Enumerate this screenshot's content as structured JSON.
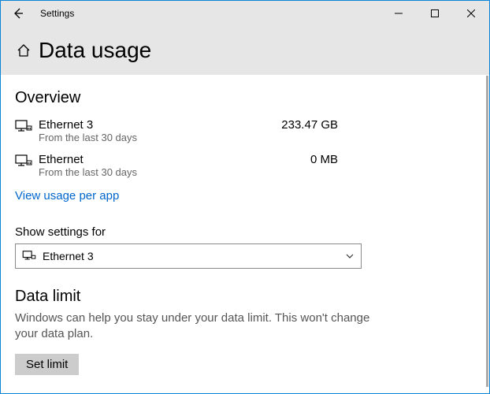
{
  "window": {
    "app_name": "Settings",
    "title": "Data usage"
  },
  "overview": {
    "heading": "Overview",
    "items": [
      {
        "name": "Ethernet 3",
        "subtitle": "From the last 30 days",
        "usage": "233.47 GB"
      },
      {
        "name": "Ethernet",
        "subtitle": "From the last 30 days",
        "usage": "0 MB"
      }
    ],
    "link": "View usage per app"
  },
  "settings_for": {
    "label": "Show settings for",
    "selected": "Ethernet 3"
  },
  "data_limit": {
    "heading": "Data limit",
    "description": "Windows can help you stay under your data limit. This won't change your data plan.",
    "button": "Set limit"
  }
}
